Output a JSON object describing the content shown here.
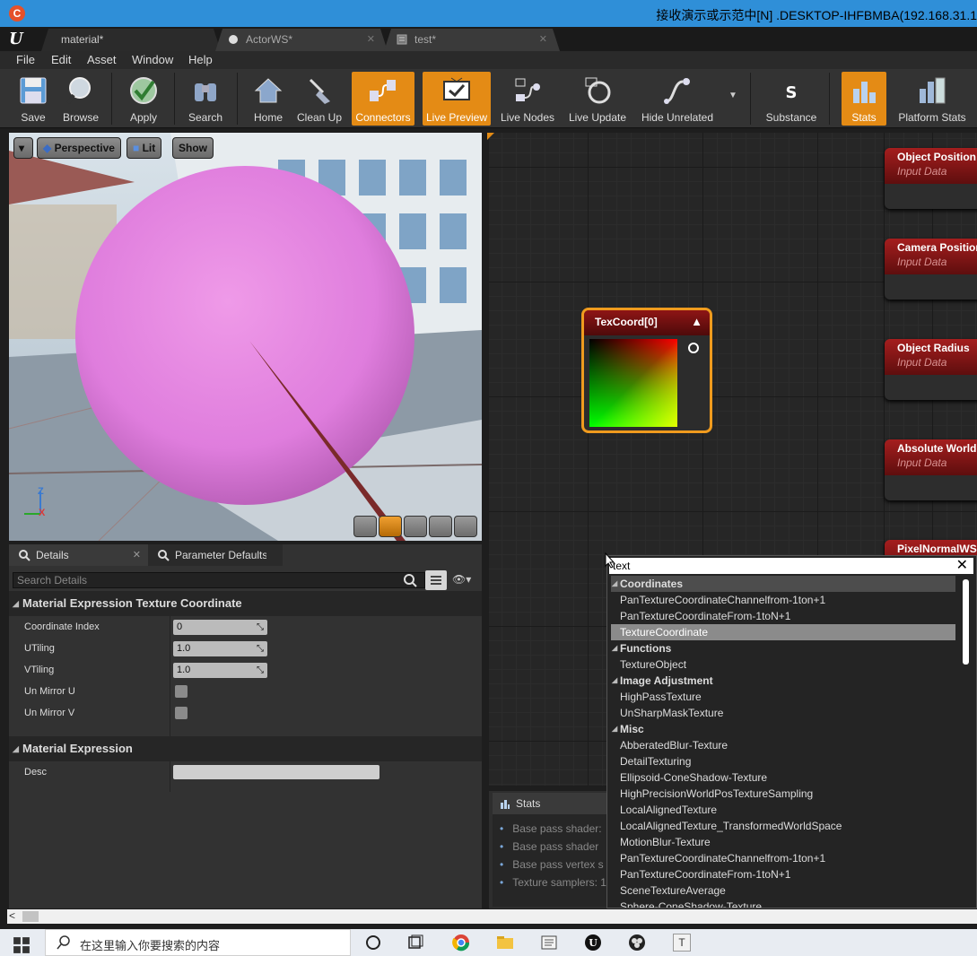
{
  "remote_bar": {
    "title": "接收演示或示范中[N] .DESKTOP-IHFBMBA(192.168.31.1"
  },
  "tabs": [
    {
      "label": "material*"
    },
    {
      "label": "ActorWS*"
    },
    {
      "label": "test*"
    }
  ],
  "menu": [
    "File",
    "Edit",
    "Asset",
    "Window",
    "Help"
  ],
  "toolbar": {
    "save": "Save",
    "browse": "Browse",
    "apply": "Apply",
    "search": "Search",
    "home": "Home",
    "clean_up": "Clean Up",
    "connectors": "Connectors",
    "live_preview": "Live Preview",
    "live_nodes": "Live Nodes",
    "live_update": "Live Update",
    "hide_unrelated": "Hide Unrelated",
    "substance": "Substance",
    "stats": "Stats",
    "platform_stats": "Platform Stats"
  },
  "viewport": {
    "perspective": "Perspective",
    "lit": "Lit",
    "show": "Show",
    "axis_z": "Z",
    "axis_x": "X"
  },
  "details": {
    "tab_details": "Details",
    "tab_params": "Parameter Defaults",
    "search_placeholder": "Search Details",
    "category_texcoord": "Material Expression Texture Coordinate",
    "coordinate_index_label": "Coordinate Index",
    "coordinate_index_value": "0",
    "utiling_label": "UTiling",
    "utiling_value": "1.0",
    "vtiling_label": "VTiling",
    "vtiling_value": "1.0",
    "unmirror_u_label": "Un Mirror U",
    "unmirror_v_label": "Un Mirror V",
    "category_expression": "Material Expression",
    "desc_label": "Desc"
  },
  "graph": {
    "nodes": [
      {
        "title": "Object Position",
        "subtitle": "Input Data"
      },
      {
        "title": "Camera Position",
        "subtitle": "Input Data"
      },
      {
        "title": "Object Radius",
        "subtitle": "Input Data"
      },
      {
        "title": "Absolute World",
        "subtitle": "Input Data"
      },
      {
        "title": "PixelNormalWS",
        "subtitle": ""
      }
    ],
    "texcoord_title": "TexCoord[0]"
  },
  "stats": {
    "tab": "Stats",
    "lines": [
      "Base pass shader:",
      "Base pass shader",
      "Base pass vertex s",
      "Texture samplers: 1"
    ]
  },
  "palette": {
    "search_value": "text",
    "rows": [
      {
        "kind": "cat",
        "label": "Coordinates"
      },
      {
        "kind": "item",
        "label": "PanTextureCoordinateChannelfrom-1ton+1"
      },
      {
        "kind": "item",
        "label": "PanTextureCoordinateFrom-1toN+1"
      },
      {
        "kind": "item",
        "label": "TextureCoordinate"
      },
      {
        "kind": "cat",
        "label": "Functions"
      },
      {
        "kind": "item",
        "label": "TextureObject"
      },
      {
        "kind": "cat",
        "label": "Image Adjustment"
      },
      {
        "kind": "item",
        "label": "HighPassTexture"
      },
      {
        "kind": "item",
        "label": "UnSharpMaskTexture"
      },
      {
        "kind": "cat",
        "label": "Misc"
      },
      {
        "kind": "item",
        "label": "AbberatedBlur-Texture"
      },
      {
        "kind": "item",
        "label": "DetailTexturing"
      },
      {
        "kind": "item",
        "label": "Ellipsoid-ConeShadow-Texture"
      },
      {
        "kind": "item",
        "label": "HighPrecisionWorldPosTextureSampling"
      },
      {
        "kind": "item",
        "label": "LocalAlignedTexture"
      },
      {
        "kind": "item",
        "label": "LocalAlignedTexture_TransformedWorldSpace"
      },
      {
        "kind": "item",
        "label": "MotionBlur-Texture"
      },
      {
        "kind": "item",
        "label": "PanTextureCoordinateChannelfrom-1ton+1"
      },
      {
        "kind": "item",
        "label": "PanTextureCoordinateFrom-1toN+1"
      },
      {
        "kind": "item",
        "label": "SceneTextureAverage"
      },
      {
        "kind": "item",
        "label": "Sphere-ConeShadow-Texture"
      }
    ]
  },
  "taskbar": {
    "search_placeholder": "在这里输入你要搜索的内容",
    "app_t": "T"
  },
  "colors": {
    "accent_orange": "#e48b15",
    "node_header_red": "#a51e1e",
    "sphere_pink": "#e07be0",
    "remote_bar_blue": "#2f8fd8"
  }
}
